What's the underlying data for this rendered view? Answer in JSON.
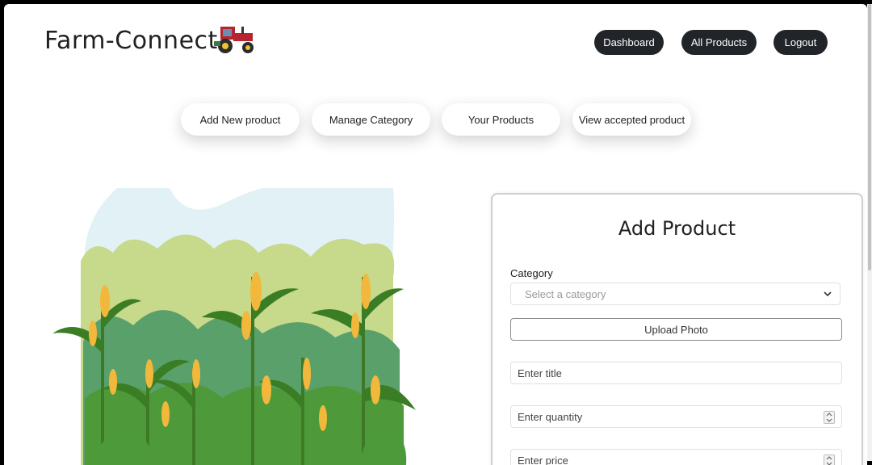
{
  "header": {
    "brand": "Farm-Connect",
    "nav": {
      "dashboard": "Dashboard",
      "all_products": "All Products",
      "logout": "Logout"
    }
  },
  "actions": {
    "add_new": "Add New product",
    "manage_category": "Manage Category",
    "your_products": "Your Products",
    "view_accepted": "View accepted product"
  },
  "form": {
    "title": "Add Product",
    "category_label": "Category",
    "category_placeholder": "Select a category",
    "upload_label": "Upload Photo",
    "title_placeholder": "Enter title",
    "quantity_placeholder": "Enter quantity",
    "price_placeholder": "Enter price"
  },
  "colors": {
    "nav_button": "#212529",
    "illustration_sky": "#e2f1f6",
    "illustration_green": "#4b8b2c",
    "corn": "#f2b83c"
  },
  "icons": {
    "brand_logo": "tractor-icon",
    "select_arrow": "chevron-down-icon",
    "number_spinner": "spinner-icon"
  }
}
